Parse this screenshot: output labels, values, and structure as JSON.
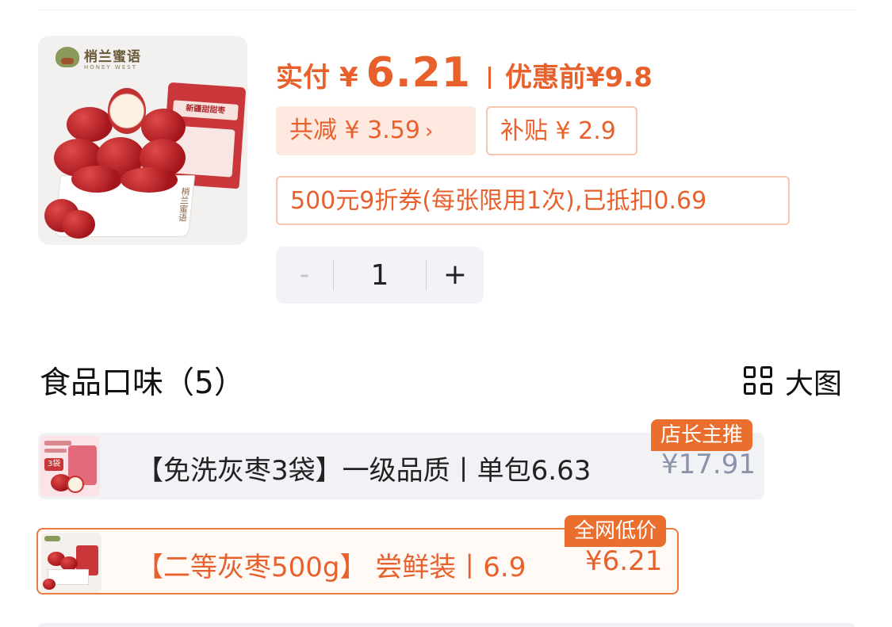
{
  "product": {
    "brand_logo_text": "梢兰蜜语",
    "brand_logo_sub": "HONEY WEST",
    "bag_label": "新疆甜甜枣"
  },
  "price": {
    "paid_label": "实付",
    "currency": "¥",
    "paid_amount": "6.21",
    "before_label": "优惠前",
    "before_amount": "¥9.8"
  },
  "discounts": {
    "total_reduction": "共减 ¥ 3.59",
    "total_chevron": "›",
    "subsidy": "补贴 ¥ 2.9",
    "coupon": "500元9折券(每张限用1次),已抵扣0.69"
  },
  "quantity": {
    "minus": "-",
    "value": "1",
    "plus": "+"
  },
  "flavors": {
    "title": "食品口味（5）",
    "view_toggle_label": "大图",
    "items": [
      {
        "title": "【免洗灰枣3袋】一级品质丨单包6.63",
        "price": "¥17.91",
        "tag": "店长主推",
        "thumb_label": "3袋",
        "selected": false
      },
      {
        "title": "【二等灰枣500g】 尝鲜装丨6.9",
        "price": "¥6.21",
        "tag": "全网低价",
        "selected": true
      }
    ]
  },
  "colors": {
    "accent": "#e8612c",
    "accent_light": "#fde9df",
    "border_light": "#f8c6ad",
    "muted_price": "#8b93a8",
    "row_bg": "#f1f2f6"
  }
}
